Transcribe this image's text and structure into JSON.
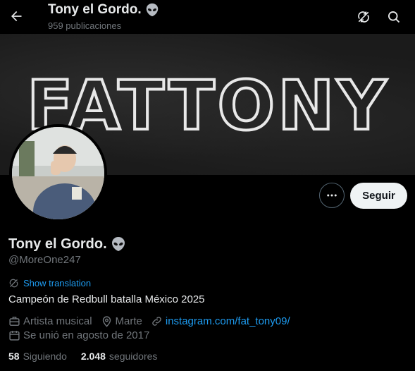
{
  "header": {
    "name": "Tony el Gordo.",
    "post_count": "959 publicaciones"
  },
  "banner": {
    "logo_text": "FATTONY"
  },
  "actions": {
    "follow_label": "Seguir"
  },
  "profile": {
    "name": "Tony el Gordo.",
    "handle": "@MoreOne247",
    "translate_label": "Show translation",
    "bio": "Campeón de Redbull batalla México 2025",
    "category": "Artista musical",
    "location": "Marte",
    "link": "instagram.com/fat_tony09/",
    "joined": "Se unió en agosto de 2017"
  },
  "stats": {
    "following_count": "58",
    "following_label": "Siguiendo",
    "followers_count": "2.048",
    "followers_label": "seguidores"
  },
  "colors": {
    "background": "#000000",
    "text_primary": "#e7e9ea",
    "text_secondary": "#71767b",
    "accent": "#1d9bf0",
    "follow_button_bg": "#eff3f4"
  },
  "icons": [
    "back-arrow-icon",
    "alien-emoji-icon",
    "translate-icon",
    "search-icon",
    "more-dots-icon",
    "briefcase-icon",
    "location-pin-icon",
    "link-icon",
    "calendar-icon"
  ]
}
